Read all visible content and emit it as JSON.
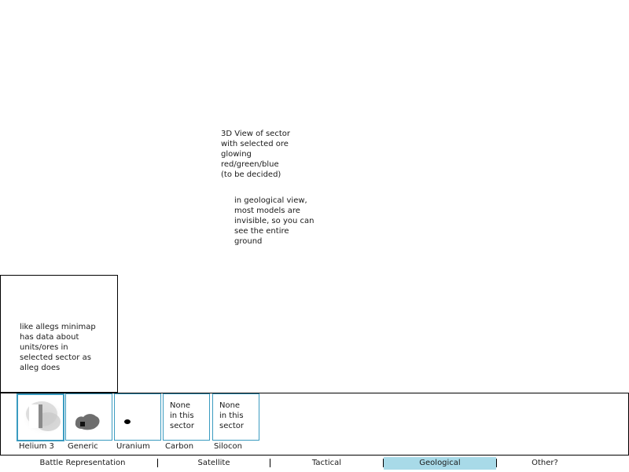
{
  "notes": {
    "view_3d_lines": [
      "3D View of sector",
      "with selected ore",
      "glowing",
      "red/green/blue",
      "(to be decided)"
    ],
    "geological_lines": [
      "in geological view,",
      "most models are",
      "invisible, so you can",
      "see the entire",
      "ground"
    ]
  },
  "minimap": {
    "lines": [
      "like allegs minimap",
      "has data about",
      "units/ores in",
      "selected sector as",
      "alleg does"
    ]
  },
  "ores": [
    {
      "label": "Helium 3",
      "icon": "helium-cloud-icon",
      "selected": true
    },
    {
      "label": "Generic",
      "icon": "generic-ore-icon"
    },
    {
      "label": "Uranium",
      "icon": "uranium-ore-icon"
    },
    {
      "label": "Carbon",
      "none_lines": [
        "None",
        "in this",
        "sector"
      ]
    },
    {
      "label": "Silocon",
      "none_lines": [
        "None",
        "in this",
        "sector"
      ]
    }
  ],
  "tabs": [
    {
      "label": "Battle Representation"
    },
    {
      "label": "Satellite"
    },
    {
      "label": "Tactical"
    },
    {
      "label": "Geological",
      "active": true
    },
    {
      "label": "Other?"
    }
  ],
  "colors": {
    "accent_border": "#3a9bc0",
    "active_tab": "#a8dae8"
  }
}
